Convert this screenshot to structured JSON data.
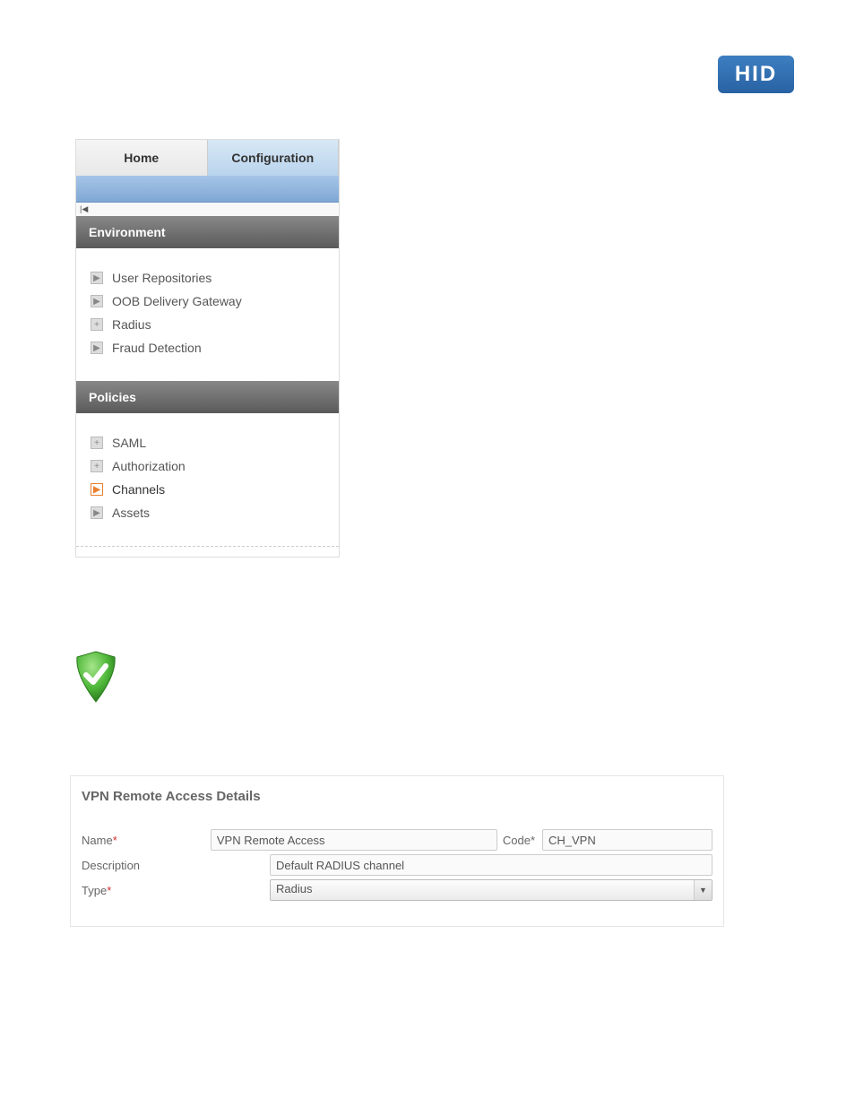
{
  "logo": {
    "text": "HID"
  },
  "tabs": {
    "home": "Home",
    "configuration": "Configuration"
  },
  "sidebar": {
    "sections": [
      {
        "title": "Environment",
        "items": [
          {
            "label": "User Repositories",
            "icon": "arrow-gray"
          },
          {
            "label": "OOB Delivery Gateway",
            "icon": "arrow-gray"
          },
          {
            "label": "Radius",
            "icon": "plus-gray"
          },
          {
            "label": "Fraud Detection",
            "icon": "arrow-gray"
          }
        ]
      },
      {
        "title": "Policies",
        "items": [
          {
            "label": "SAML",
            "icon": "plus-gray"
          },
          {
            "label": "Authorization",
            "icon": "plus-gray"
          },
          {
            "label": "Channels",
            "icon": "arrow-orange",
            "active": true
          },
          {
            "label": "Assets",
            "icon": "arrow-gray"
          }
        ]
      }
    ]
  },
  "details": {
    "title": "VPN Remote Access Details",
    "name_label": "Name",
    "name_value": "VPN Remote Access",
    "code_label": "Code",
    "code_value": "CH_VPN",
    "description_label": "Description",
    "description_value": "Default RADIUS channel",
    "type_label": "Type",
    "type_value": "Radius"
  }
}
